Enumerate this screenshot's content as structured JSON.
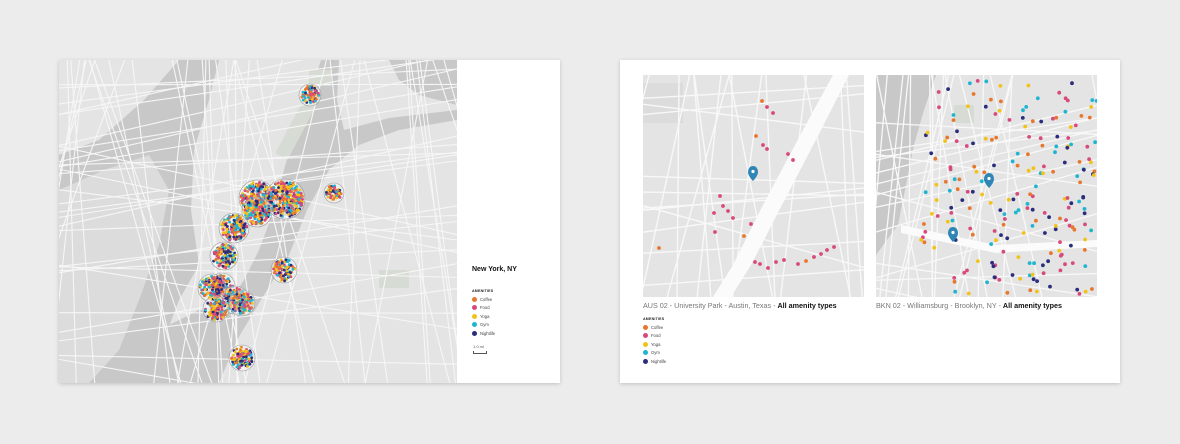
{
  "colors": {
    "coffee": "#e8772e",
    "food": "#d84a7d",
    "yoga": "#f2c218",
    "gym": "#1eb5d0",
    "nightlife": "#2b2d7c",
    "water": "#c8c8c8",
    "land": "#e4e4e4",
    "park": "#d6dcd4",
    "road": "#f6f6f6",
    "pin": "#2f86b5"
  },
  "left_panel": {
    "city": "New York, NY",
    "legend_heading": "AMENITIES",
    "scale_label": "1.0 mi"
  },
  "right_panel": {
    "aus": {
      "caption_prefix": "AUS 02 - University Park - Austin, Texas - ",
      "caption_bold": "All amenity types"
    },
    "bkn": {
      "caption_prefix": "BKN 02 - Williamsburg - Brooklyn, NY - ",
      "caption_bold": "All amenity types"
    },
    "legend_heading": "AMENITIES"
  },
  "legend": [
    {
      "label": "Coffee",
      "color_key": "coffee"
    },
    {
      "label": "Food",
      "color_key": "food"
    },
    {
      "label": "Yoga",
      "color_key": "yoga"
    },
    {
      "label": "Gym",
      "color_key": "gym"
    },
    {
      "label": "Nightlife",
      "color_key": "nightlife"
    }
  ]
}
